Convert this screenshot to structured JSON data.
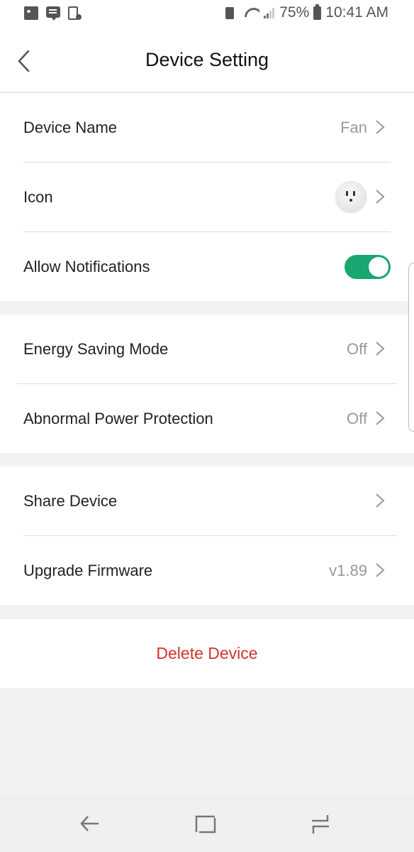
{
  "status_bar": {
    "left_icons": [
      "gallery-icon",
      "message-icon",
      "screen-record-icon"
    ],
    "right_icons": [
      "battery-saver-icon",
      "wifi-icon",
      "signal-icon",
      "battery-icon"
    ],
    "battery": "75%",
    "time": "10:41 AM"
  },
  "header": {
    "title": "Device Setting",
    "back_icon": "chevron-left-icon"
  },
  "groups": [
    {
      "rows": [
        {
          "label": "Device Name",
          "value": "Fan",
          "type": "link"
        },
        {
          "label": "Icon",
          "value": "smart-plug-image",
          "type": "link"
        },
        {
          "label": "Allow Notifications",
          "type": "toggle",
          "checked": true
        }
      ]
    },
    {
      "rows": [
        {
          "label": "Energy Saving Mode",
          "value": "Off",
          "type": "link"
        },
        {
          "label": "Abnormal Power Protection",
          "value": "Off",
          "type": "link"
        }
      ]
    },
    {
      "rows": [
        {
          "label": "Share Device",
          "value": "",
          "type": "link"
        },
        {
          "label": "Upgrade Firmware",
          "value": "v1.89",
          "type": "link"
        }
      ]
    }
  ],
  "delete_label": "Delete Device",
  "colors": {
    "accent": "#1aa671",
    "danger": "#d0342c",
    "background": "#f2f2f2"
  },
  "navbar": {
    "buttons": [
      "back-nav-icon",
      "home-nav-icon",
      "recents-nav-icon"
    ]
  }
}
